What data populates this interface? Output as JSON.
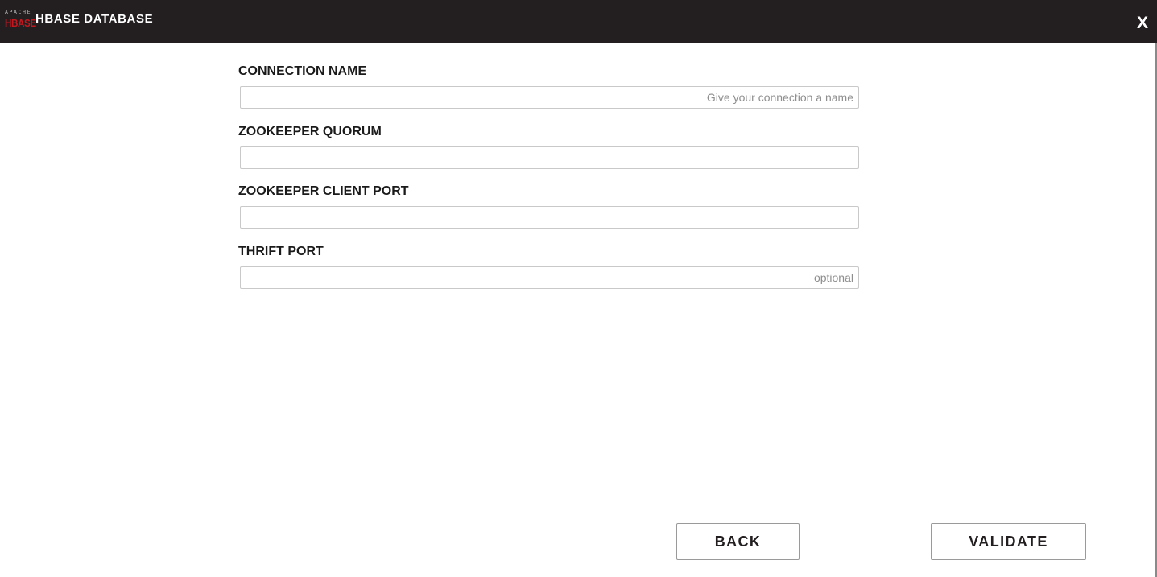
{
  "window": {
    "logo_top": "APACHE",
    "logo_bottom": "HBASE",
    "title": "HBASE DATABASE",
    "close_label": "X"
  },
  "form": {
    "fields": [
      {
        "label": "CONNECTION NAME",
        "value": "",
        "placeholder": "Give your connection a name"
      },
      {
        "label": "ZOOKEEPER QUORUM",
        "value": "",
        "placeholder": ""
      },
      {
        "label": "ZOOKEEPER CLIENT PORT",
        "value": "",
        "placeholder": ""
      },
      {
        "label": "THRIFT PORT",
        "value": "",
        "placeholder": "optional"
      }
    ]
  },
  "buttons": {
    "back_label": "BACK",
    "validate_label": "VALIDATE"
  },
  "colors": {
    "titlebar": "#231f20",
    "logo_red": "#c1191f"
  }
}
